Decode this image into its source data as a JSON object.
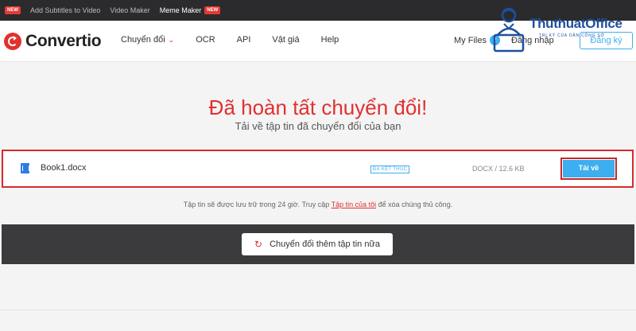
{
  "topbar": {
    "items": [
      {
        "label": "",
        "badge": "NEW"
      },
      {
        "label": "Add Subtitles to Video"
      },
      {
        "label": "Video Maker"
      },
      {
        "label": "Meme Maker",
        "badge": "NEW"
      }
    ]
  },
  "header": {
    "logo": "Convertio",
    "nav": [
      "Chuyển đổi",
      "OCR",
      "API",
      "Vật giá",
      "Help"
    ],
    "my_files_label": "My Files",
    "my_files_count": "2",
    "login": "Đăng nhập",
    "signup": "Đăng ký"
  },
  "watermark": {
    "title": "ThuthuatOffice",
    "subtitle": "TRI KỶ CỦA DÂN CÔNG SỞ"
  },
  "main": {
    "title": "Đã hoàn tất chuyển đổi!",
    "subtitle": "Tải về tập tin đã chuyển đổi của bạn"
  },
  "file": {
    "name": "Book1.docx",
    "status": "ĐÃ KẾT THÚC",
    "meta": "DOCX / 12.6 KB",
    "download_label": "Tải về"
  },
  "note": {
    "before": "Tập tin sẽ được lưu trữ trong 24 giờ. Truy cập ",
    "link": "Tập tin của tôi",
    "after": " để xóa chúng thủ công."
  },
  "more_button": "Chuyển đổi thêm tập tin nữa",
  "colors": {
    "brand_red": "#e0312f",
    "accent_blue": "#3daef0",
    "dark_band": "#3b3b3d"
  }
}
